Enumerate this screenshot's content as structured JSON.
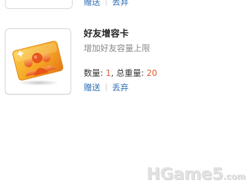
{
  "previous_item": {
    "actions": {
      "gift": "赠送",
      "discard": "丢弃"
    }
  },
  "item": {
    "icon": "friend-capacity-card-icon",
    "name": "好友增容卡",
    "description": "增加好友容量上限",
    "quantity_label": "数量:",
    "quantity": "1",
    "weight_label": ", 总重量:",
    "total_weight": "20",
    "actions": {
      "gift": "赠送",
      "discard": "丢弃"
    }
  },
  "watermark": {
    "main": "HGame5",
    "suffix": ".com"
  },
  "colors": {
    "link": "#2f6fb7",
    "value_highlight": "#e2572b",
    "card_orange": "#f39a1e",
    "card_yellow": "#f8c63a"
  }
}
